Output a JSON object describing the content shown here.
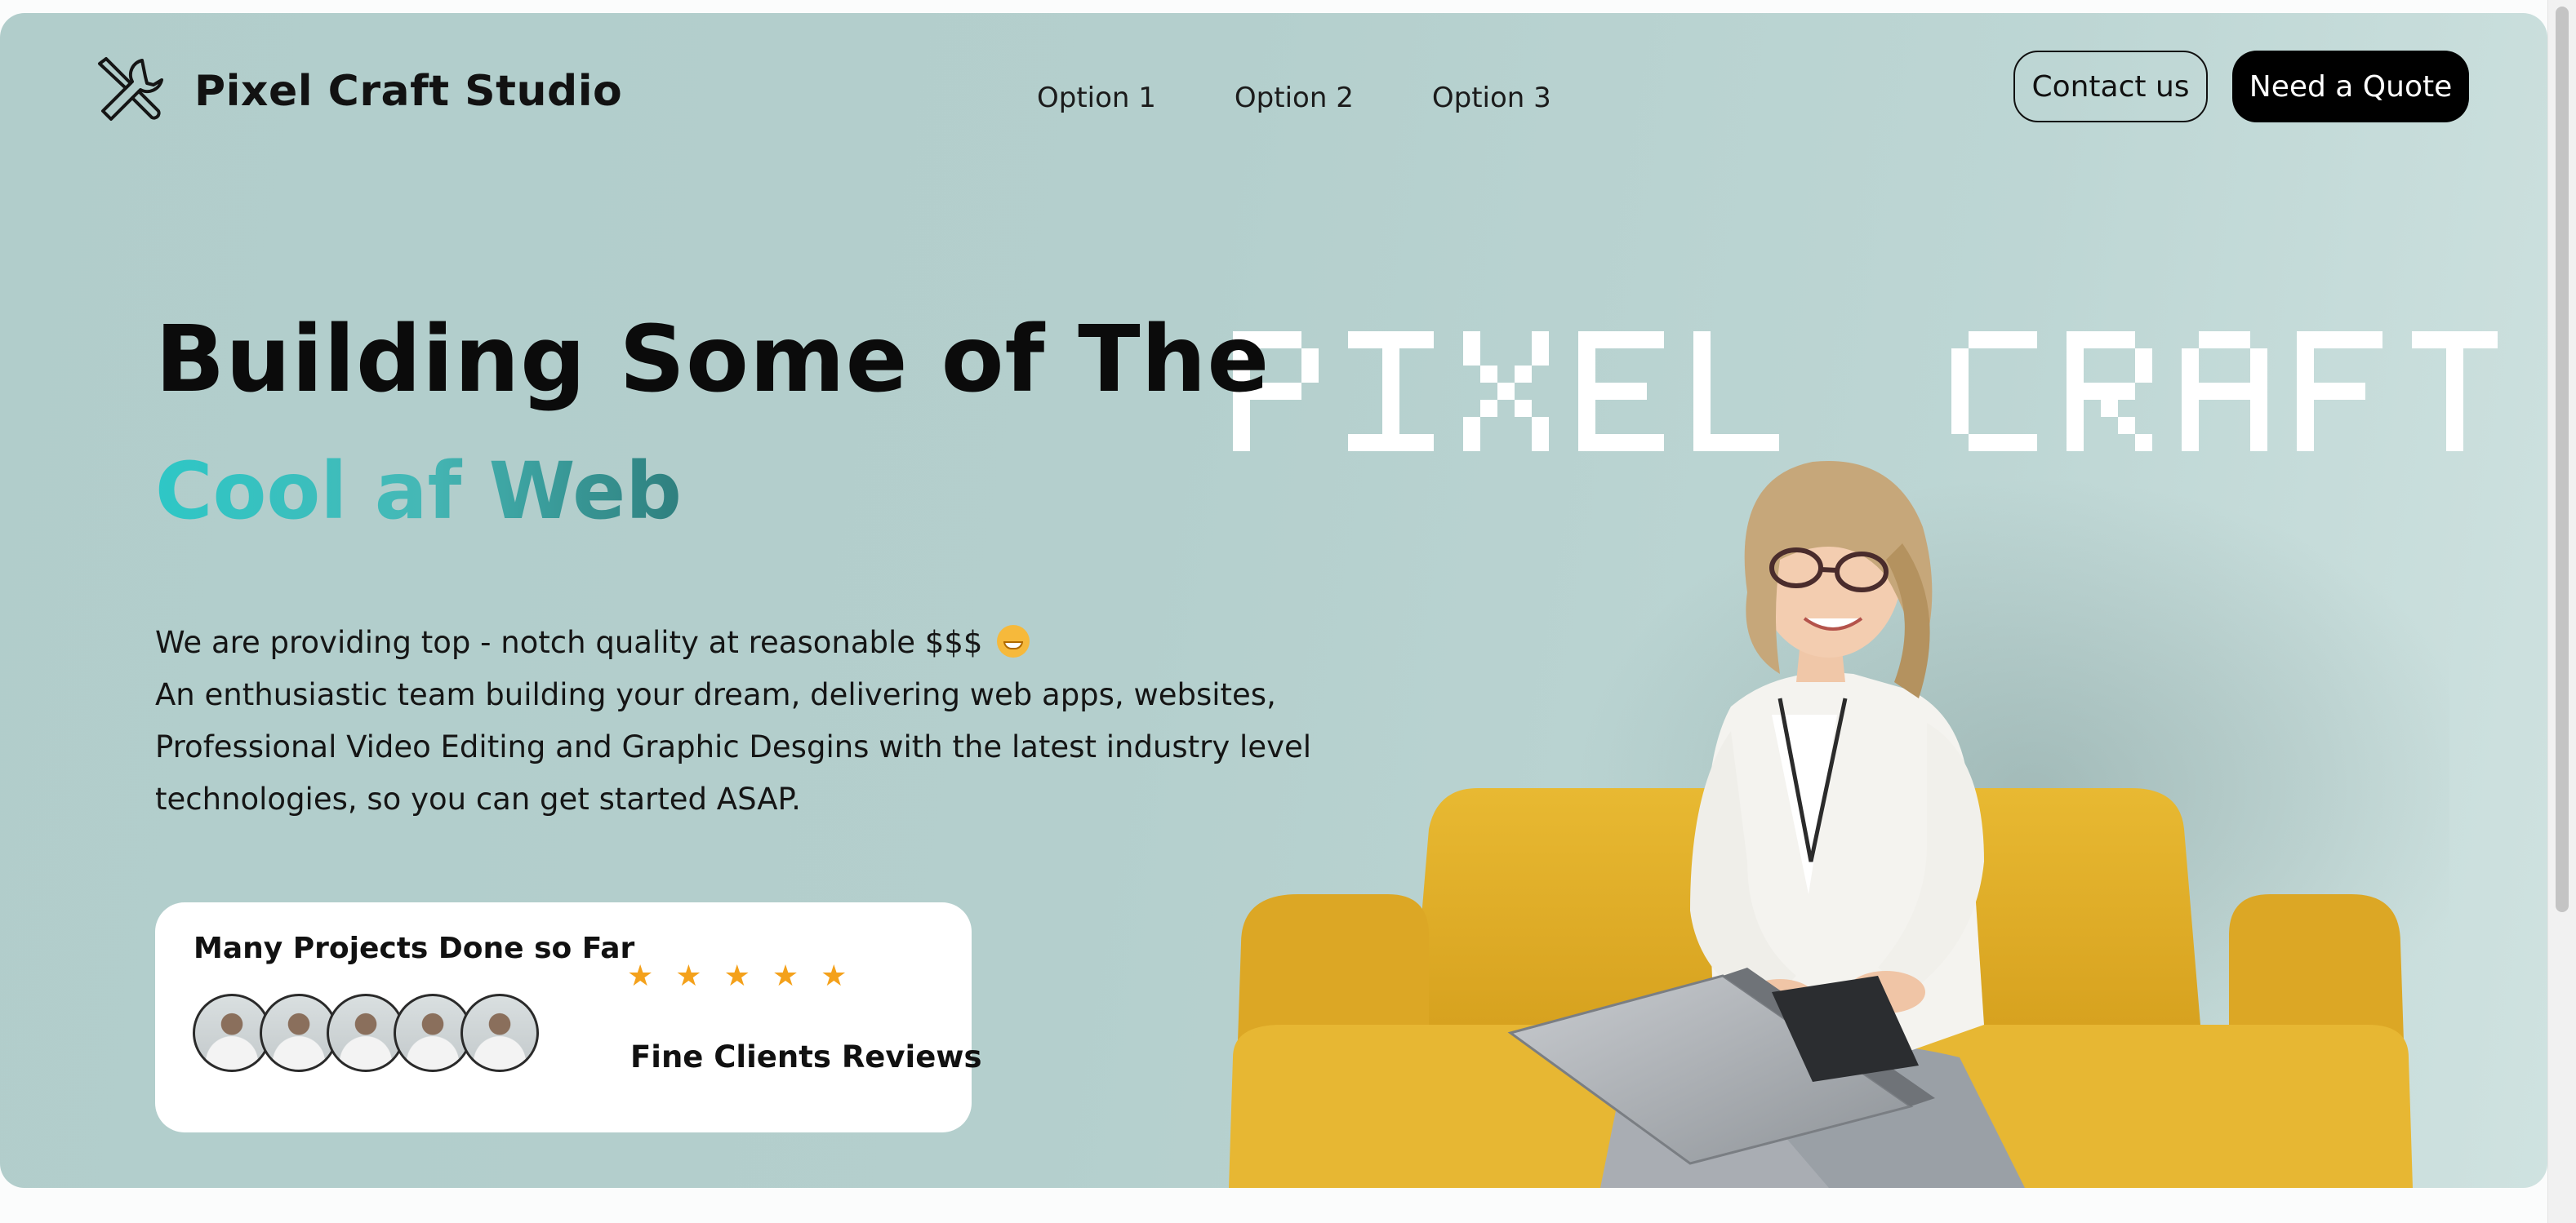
{
  "nav": {
    "brand": "Pixel Craft Studio",
    "logo_icon": "tools-icon",
    "links": [
      "Option 1",
      "Option 2",
      "Option 3"
    ],
    "contact_label": "Contact us",
    "quote_label": "Need a Quote"
  },
  "hero": {
    "headline": "Building Some of The",
    "subheadline": "Cool af Web",
    "pixel_title_1": "PIXEL",
    "pixel_title_2": "CRAFT",
    "desc_line1": "We are providing top - notch quality at reasonable $$$",
    "desc_emoji": "grinning-face-icon",
    "desc_rest": "An enthusiastic team building your dream, delivering web apps, websites, Professional Video Editing and Graphic Desgins with the latest industry level technologies, so you can get started ASAP.",
    "image": "woman-on-yellow-sofa-with-laptop"
  },
  "card": {
    "title": "Many Projects Done so Far",
    "avatar_count": 5,
    "rating_stars": 5,
    "reviews_label": "Fine Clients Reviews"
  },
  "colors": {
    "hero_bg": "#b4cfcd",
    "accent_teal": "#2ec7c6",
    "accent_dark_teal": "#2f7f7e",
    "star": "#f4a11b",
    "sofa": "#e3b32c",
    "button_dark": "#000000"
  }
}
